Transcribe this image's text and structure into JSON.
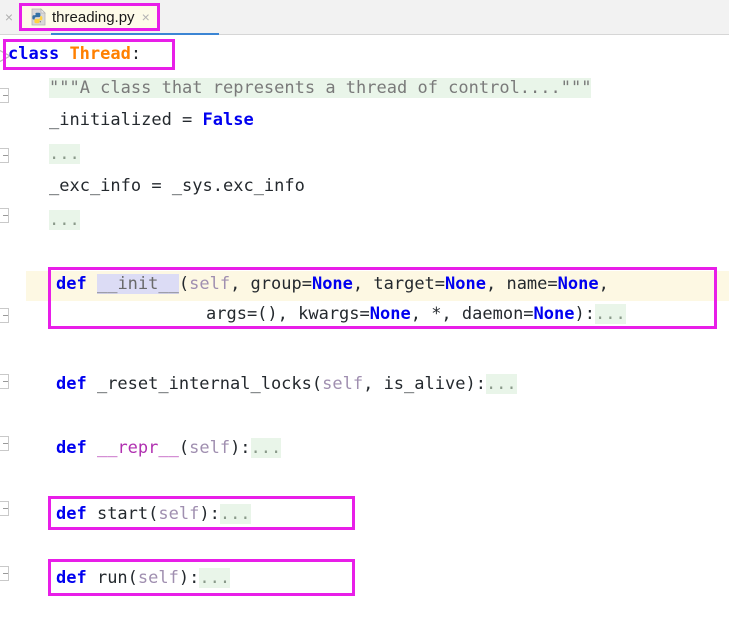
{
  "window": {
    "app": "code-editor",
    "background_color": "#ffffff"
  },
  "tabbar": {
    "background_color": "#f2f2f2",
    "left_close_glyph": "×",
    "active_tab": {
      "label": "threading.py",
      "icon": "python-file-icon",
      "close_glyph": "×",
      "highlight_color": "#e81ee8",
      "background_color": "#fdfbe8",
      "underline_color": "#3b85d4"
    }
  },
  "editor": {
    "language": "python",
    "folded_placeholder": "...",
    "current_line_color": "#fdf8e3",
    "folded_region_color": "#e9f5e9",
    "annotation_color": "#e81ee8",
    "lines": [
      {
        "id": "line-class-thread",
        "indent": 0,
        "tokens": [
          {
            "text": "class",
            "type": "keyword"
          },
          {
            "text": " ",
            "type": "plain"
          },
          {
            "text": "Thread",
            "type": "class-name"
          },
          {
            "text": ":",
            "type": "punctuation"
          }
        ]
      },
      {
        "id": "line-docstring",
        "indent": 1,
        "tokens": [
          {
            "text": "\"\"\"A class that represents a thread of control....\"\"\"",
            "type": "docstring"
          }
        ]
      },
      {
        "id": "line-initialized",
        "indent": 1,
        "tokens": [
          {
            "text": "_initialized = ",
            "type": "plain"
          },
          {
            "text": "False",
            "type": "constant"
          }
        ]
      },
      {
        "id": "line-fold-1",
        "indent": 1,
        "tokens": [
          {
            "text": "...",
            "type": "folded"
          }
        ]
      },
      {
        "id": "line-exc-info",
        "indent": 1,
        "tokens": [
          {
            "text": "_exc_info = _sys.exc_info",
            "type": "plain"
          }
        ]
      },
      {
        "id": "line-fold-2",
        "indent": 1,
        "tokens": [
          {
            "text": "...",
            "type": "folded"
          }
        ]
      },
      {
        "id": "line-def-init",
        "indent": 1,
        "tokens": [
          {
            "text": "def",
            "type": "keyword"
          },
          {
            "text": " ",
            "type": "plain"
          },
          {
            "text": "__init__",
            "type": "dunder-highlighted"
          },
          {
            "text": "(",
            "type": "punctuation"
          },
          {
            "text": "self",
            "type": "self"
          },
          {
            "text": ", group=",
            "type": "plain"
          },
          {
            "text": "None",
            "type": "constant"
          },
          {
            "text": ", target=",
            "type": "plain"
          },
          {
            "text": "None",
            "type": "constant"
          },
          {
            "text": ", name=",
            "type": "plain"
          },
          {
            "text": "None",
            "type": "constant"
          },
          {
            "text": ",",
            "type": "punctuation"
          }
        ]
      },
      {
        "id": "line-def-init-cont",
        "indent": 4,
        "tokens": [
          {
            "text": "args=(), kwargs=",
            "type": "plain"
          },
          {
            "text": "None",
            "type": "constant"
          },
          {
            "text": ", *, daemon=",
            "type": "plain"
          },
          {
            "text": "None",
            "type": "constant"
          },
          {
            "text": "):",
            "type": "punctuation"
          },
          {
            "text": "...",
            "type": "folded"
          }
        ]
      },
      {
        "id": "line-def-reset-internal-locks",
        "indent": 1,
        "tokens": [
          {
            "text": "def",
            "type": "keyword"
          },
          {
            "text": " _reset_internal_locks",
            "type": "plain"
          },
          {
            "text": "(",
            "type": "punctuation"
          },
          {
            "text": "self",
            "type": "self"
          },
          {
            "text": ", is_alive",
            "type": "plain"
          },
          {
            "text": "):",
            "type": "punctuation"
          },
          {
            "text": "...",
            "type": "folded"
          }
        ]
      },
      {
        "id": "line-def-repr",
        "indent": 1,
        "tokens": [
          {
            "text": "def",
            "type": "keyword"
          },
          {
            "text": " ",
            "type": "plain"
          },
          {
            "text": "__repr__",
            "type": "dunder-magic"
          },
          {
            "text": "(",
            "type": "punctuation"
          },
          {
            "text": "self",
            "type": "self"
          },
          {
            "text": "):",
            "type": "punctuation"
          },
          {
            "text": "...",
            "type": "folded"
          }
        ]
      },
      {
        "id": "line-def-start",
        "indent": 1,
        "tokens": [
          {
            "text": "def",
            "type": "keyword"
          },
          {
            "text": " start",
            "type": "plain"
          },
          {
            "text": "(",
            "type": "punctuation"
          },
          {
            "text": "self",
            "type": "self"
          },
          {
            "text": "):",
            "type": "punctuation"
          },
          {
            "text": "...",
            "type": "folded"
          }
        ]
      },
      {
        "id": "line-def-run",
        "indent": 1,
        "tokens": [
          {
            "text": "def",
            "type": "keyword"
          },
          {
            "text": " run",
            "type": "plain"
          },
          {
            "text": "(",
            "type": "punctuation"
          },
          {
            "text": "self",
            "type": "self"
          },
          {
            "text": "):",
            "type": "punctuation"
          },
          {
            "text": "...",
            "type": "folded"
          }
        ]
      }
    ],
    "fold_markers": [
      {
        "id": "fold-marker-class",
        "state": "expanded"
      },
      {
        "id": "fold-marker-docstring",
        "state": "collapsed"
      },
      {
        "id": "fold-marker-1",
        "state": "collapsed"
      },
      {
        "id": "fold-marker-2",
        "state": "collapsed"
      },
      {
        "id": "fold-marker-init",
        "state": "collapsed"
      },
      {
        "id": "fold-marker-reset",
        "state": "collapsed"
      },
      {
        "id": "fold-marker-repr",
        "state": "collapsed"
      },
      {
        "id": "fold-marker-start",
        "state": "collapsed"
      },
      {
        "id": "fold-marker-run",
        "state": "collapsed"
      }
    ],
    "annotations": [
      {
        "id": "annotation-class-thread",
        "target": "line-class-thread"
      },
      {
        "id": "annotation-def-init",
        "target": "line-def-init"
      },
      {
        "id": "annotation-def-start",
        "target": "line-def-start"
      },
      {
        "id": "annotation-def-run",
        "target": "line-def-run"
      }
    ]
  }
}
